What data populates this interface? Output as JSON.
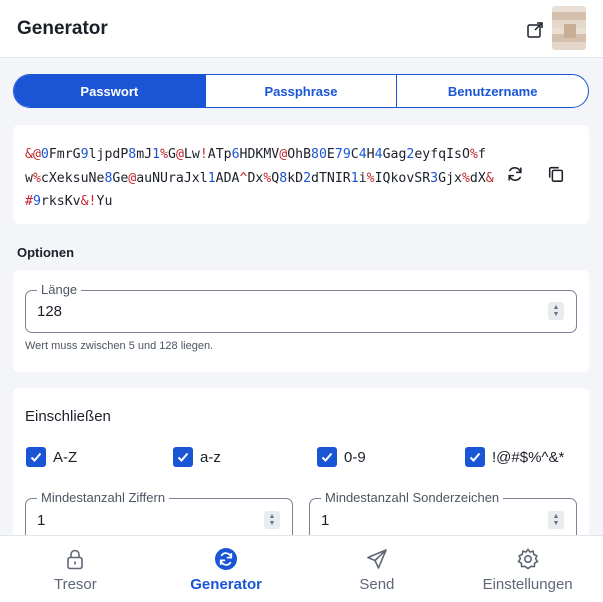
{
  "header": {
    "title": "Generator",
    "popout_icon": "popout-icon",
    "avatar": "avatar"
  },
  "tabs": [
    {
      "label": "Passwort",
      "active": true
    },
    {
      "label": "Passphrase",
      "active": false
    },
    {
      "label": "Benutzername",
      "active": false
    }
  ],
  "password": {
    "segments": [
      {
        "t": "&@",
        "c": "sym"
      },
      {
        "t": "0",
        "c": "num"
      },
      {
        "t": "FmrG",
        "c": ""
      },
      {
        "t": "9",
        "c": "num"
      },
      {
        "t": "ljpdP",
        "c": ""
      },
      {
        "t": "8",
        "c": "num"
      },
      {
        "t": "mJ",
        "c": ""
      },
      {
        "t": "1",
        "c": "num"
      },
      {
        "t": "%",
        "c": "sym"
      },
      {
        "t": "G",
        "c": ""
      },
      {
        "t": "@",
        "c": "sym"
      },
      {
        "t": "Lw",
        "c": ""
      },
      {
        "t": "!",
        "c": "sym"
      },
      {
        "t": "ATp",
        "c": ""
      },
      {
        "t": "6",
        "c": "num"
      },
      {
        "t": "HDKMV",
        "c": ""
      },
      {
        "t": "@",
        "c": "sym"
      },
      {
        "t": "OhB",
        "c": ""
      },
      {
        "t": "80",
        "c": "num"
      },
      {
        "t": "E",
        "c": ""
      },
      {
        "t": "79",
        "c": "num"
      },
      {
        "t": "C",
        "c": ""
      },
      {
        "t": "4",
        "c": "num"
      },
      {
        "t": "H",
        "c": ""
      },
      {
        "t": "4",
        "c": "num"
      },
      {
        "t": "Gag",
        "c": ""
      },
      {
        "t": "2",
        "c": "num"
      },
      {
        "t": "eyfqIsO",
        "c": ""
      },
      {
        "t": "%",
        "c": "sym"
      },
      {
        "t": "fw",
        "c": ""
      },
      {
        "t": "%",
        "c": "sym"
      },
      {
        "t": "cXeksuNe",
        "c": ""
      },
      {
        "t": "8",
        "c": "num"
      },
      {
        "t": "Ge",
        "c": ""
      },
      {
        "t": "@",
        "c": "sym"
      },
      {
        "t": "auNUraJxl",
        "c": ""
      },
      {
        "t": "1",
        "c": "num"
      },
      {
        "t": "ADA",
        "c": ""
      },
      {
        "t": "^",
        "c": "sym"
      },
      {
        "t": "Dx",
        "c": ""
      },
      {
        "t": "%",
        "c": "sym"
      },
      {
        "t": "Q",
        "c": ""
      },
      {
        "t": "8",
        "c": "num"
      },
      {
        "t": "kD",
        "c": ""
      },
      {
        "t": "2",
        "c": "num"
      },
      {
        "t": "dTNIR",
        "c": ""
      },
      {
        "t": "1",
        "c": "num"
      },
      {
        "t": "i",
        "c": ""
      },
      {
        "t": "%",
        "c": "sym"
      },
      {
        "t": "IQkovSR",
        "c": ""
      },
      {
        "t": "3",
        "c": "num"
      },
      {
        "t": "Gjx",
        "c": ""
      },
      {
        "t": "%",
        "c": "sym"
      },
      {
        "t": "dX",
        "c": ""
      },
      {
        "t": "&#",
        "c": "sym"
      },
      {
        "t": "9",
        "c": "num"
      },
      {
        "t": "rksKv",
        "c": ""
      },
      {
        "t": "&!",
        "c": "sym"
      },
      {
        "t": "Yu",
        "c": ""
      }
    ],
    "regenerate_icon": "refresh-icon",
    "copy_icon": "copy-icon"
  },
  "options": {
    "section_label": "Optionen",
    "length_label": "Länge",
    "length_value": "128",
    "length_hint": "Wert muss zwischen 5 und 128 liegen."
  },
  "include": {
    "title": "Einschließen",
    "checks": [
      {
        "label": "A-Z",
        "checked": true
      },
      {
        "label": "a-z",
        "checked": true
      },
      {
        "label": "0-9",
        "checked": true
      },
      {
        "label": "!@#$%^&*",
        "checked": true
      }
    ],
    "min_numbers_label": "Mindestanzahl Ziffern",
    "min_numbers_value": "1",
    "min_special_label": "Mindestanzahl Sonderzeichen",
    "min_special_value": "1"
  },
  "nav": [
    {
      "label": "Tresor",
      "icon": "lock-icon",
      "active": false
    },
    {
      "label": "Generator",
      "icon": "generator-icon",
      "active": true
    },
    {
      "label": "Send",
      "icon": "send-icon",
      "active": false
    },
    {
      "label": "Einstellungen",
      "icon": "gear-icon",
      "active": false
    }
  ],
  "colors": {
    "accent": "#1a55d6",
    "symbol": "#c0262d",
    "background": "#f3f5f8"
  }
}
